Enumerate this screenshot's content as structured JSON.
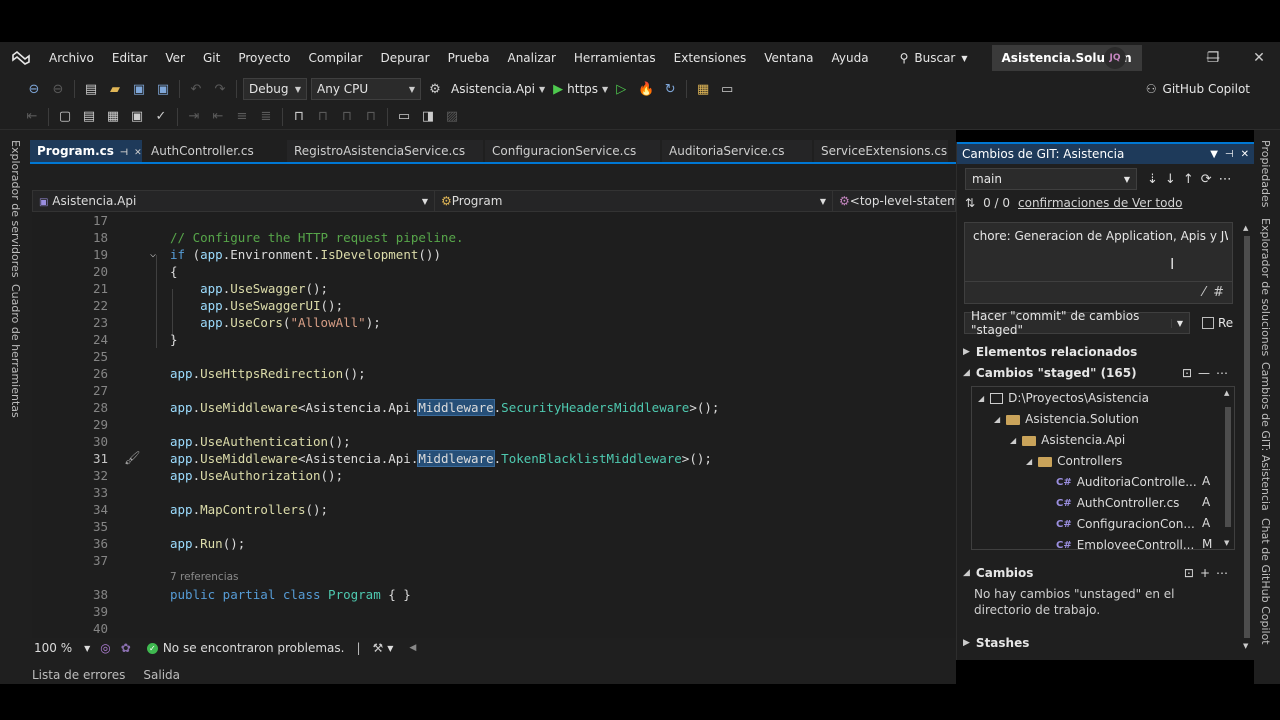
{
  "menu": {
    "items": [
      "Archivo",
      "Editar",
      "Ver",
      "Git",
      "Proyecto",
      "Compilar",
      "Depurar",
      "Prueba",
      "Analizar",
      "Herramientas",
      "Extensiones",
      "Ventana",
      "Ayuda"
    ],
    "search_label": "Buscar",
    "solution_title": "Asistencia.Solution",
    "avatar_initials": "JQ"
  },
  "toolbar": {
    "config": "Debug",
    "platform": "Any CPU",
    "startup_project": "Asistencia.Api",
    "run_profile": "https",
    "copilot_label": "GitHub Copilot"
  },
  "side": {
    "left_labels": [
      "Explorador de servidores",
      "Cuadro de herramientas"
    ],
    "right_labels": [
      "Propiedades",
      "Explorador de soluciones",
      "Cambios de GIT: Asistencia",
      "Chat de GitHub Copilot"
    ]
  },
  "editor": {
    "tabs": [
      "Program.cs",
      "AuthController.cs",
      "RegistroAsistenciaService.cs",
      "ConfiguracionService.cs",
      "AuditoriaService.cs",
      "ServiceExtensions.cs"
    ],
    "nav_project": "Asistencia.Api",
    "nav_class": "Program",
    "nav_member": "<top-level-statements-entry-point>",
    "line_numbers": [
      "17",
      "18",
      "19",
      "20",
      "21",
      "22",
      "23",
      "24",
      "25",
      "26",
      "27",
      "28",
      "29",
      "30",
      "31",
      "32",
      "33",
      "34",
      "35",
      "36",
      "37",
      "38",
      "39",
      "40"
    ],
    "references_label": "7 referencias",
    "zoom": "100 %",
    "problems": "No se encontraron problemas.",
    "bottom_tabs": [
      "Lista de errores",
      "Salida"
    ]
  },
  "git": {
    "title": "Cambios de GIT: Asistencia",
    "branch": "main",
    "commits": "0 / 0",
    "view_all_link": "confirmaciones de Ver todo",
    "commit_message": "chore: Generacion de Application, Apis y JWT y",
    "commit_button": "Hacer \"commit\" de cambios \"staged\"",
    "amend_label": "Re",
    "related_items": "Elementos relacionados",
    "staged_header": "Cambios \"staged\" (165)",
    "tree": [
      {
        "label": "D:\\Proyectos\\Asistencia",
        "type": "drive",
        "status": ""
      },
      {
        "label": "Asistencia.Solution",
        "type": "folder",
        "status": ""
      },
      {
        "label": "Asistencia.Api",
        "type": "folder",
        "status": ""
      },
      {
        "label": "Controllers",
        "type": "folder",
        "status": ""
      },
      {
        "label": "AuditoriaControlle...",
        "type": "cs",
        "status": "A"
      },
      {
        "label": "AuthController.cs",
        "type": "cs",
        "status": "A"
      },
      {
        "label": "ConfiguracionCon...",
        "type": "cs",
        "status": "A"
      },
      {
        "label": "EmployeeControll...",
        "type": "cs",
        "status": "M"
      }
    ],
    "changes_header": "Cambios",
    "unstaged_note": "No hay cambios \"unstaged\" en el directorio de trabajo.",
    "stashes": "Stashes"
  },
  "colors": {
    "accent": "#0078d4",
    "background": "#1f1f1f",
    "editor_bg": "#1e1e1e",
    "keyword": "#569cd6",
    "comment": "#57a64a",
    "type": "#4ec9b0"
  }
}
